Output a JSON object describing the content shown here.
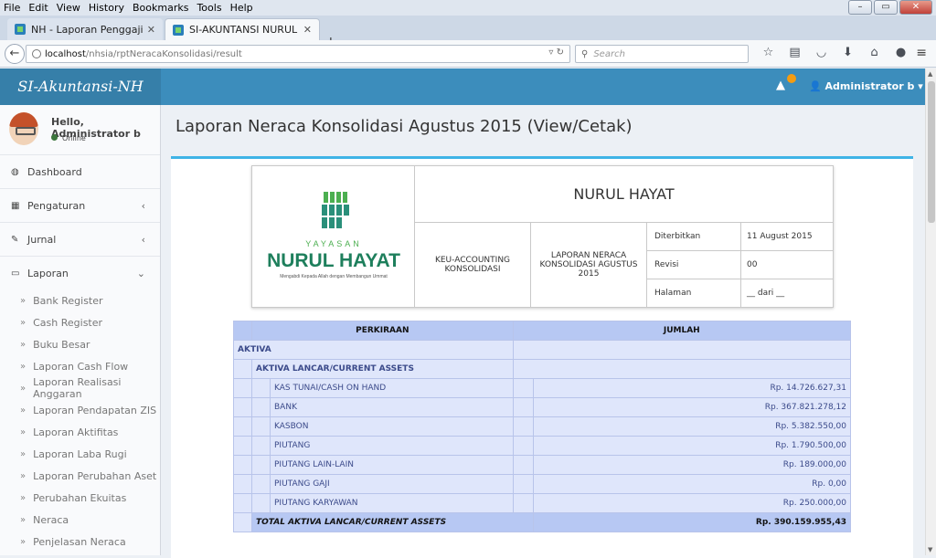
{
  "browser": {
    "menu": [
      "File",
      "Edit",
      "View",
      "History",
      "Bookmarks",
      "Tools",
      "Help"
    ],
    "tabs": [
      {
        "title": "NH - Laporan Penggajian ..."
      },
      {
        "title": "SI-AKUNTANSI NURUL HA..."
      }
    ],
    "url_host": "localhost",
    "url_path": "/nhsia/rptNeracaKonsolidasi/result",
    "search_placeholder": "Search"
  },
  "app": {
    "logo": "SI-Akuntansi-NH",
    "user_menu": "Administrator b"
  },
  "sidebar": {
    "greeting": "Hello, Administrator b",
    "status": "Online",
    "items": [
      {
        "label": "Dashboard"
      },
      {
        "label": "Pengaturan"
      },
      {
        "label": "Jurnal"
      },
      {
        "label": "Laporan"
      }
    ],
    "sub_items": [
      "Bank Register",
      "Cash Register",
      "Buku Besar",
      "Laporan Cash Flow",
      "Laporan Realisasi Anggaran",
      "Laporan Pendapatan ZIS",
      "Laporan Aktifitas",
      "Laporan Laba Rugi",
      "Laporan Perubahan Aset",
      "Perubahan Ekuitas",
      "Neraca",
      "Penjelasan Neraca"
    ]
  },
  "page": {
    "title": "Laporan Neraca Konsolidasi Agustus 2015 (View/Cetak)"
  },
  "letterhead": {
    "logo_top": "YAYASAN",
    "logo_name": "NURUL HAYAT",
    "logo_tagline": "Mengabdi Kepada Allah dengan Membangun Ummat",
    "org": "NURUL HAYAT",
    "dept": "KEU-ACCOUNTING KONSOLIDASI",
    "report": "LAPORAN NERACA KONSOLIDASI AGUSTUS 2015",
    "fields": [
      {
        "k": "Diterbitkan",
        "v": "11 August 2015"
      },
      {
        "k": "Revisi",
        "v": "00"
      },
      {
        "k": "Halaman",
        "v": "__ dari __"
      }
    ]
  },
  "report": {
    "col_account": "PERKIRAAN",
    "col_amount": "JUMLAH",
    "section": "AKTIVA",
    "subsection": "AKTIVA LANCAR/CURRENT ASSETS",
    "rows": [
      {
        "name": "KAS TUNAI/CASH ON HAND",
        "amount": "Rp. 14.726.627,31"
      },
      {
        "name": "BANK",
        "amount": "Rp. 367.821.278,12"
      },
      {
        "name": "KASBON",
        "amount": "Rp. 5.382.550,00"
      },
      {
        "name": "PIUTANG",
        "amount": "Rp. 1.790.500,00"
      },
      {
        "name": "PIUTANG LAIN-LAIN",
        "amount": "Rp. 189.000,00"
      },
      {
        "name": "PIUTANG GAJI",
        "amount": "Rp. 0,00"
      },
      {
        "name": "PIUTANG KARYAWAN",
        "amount": "Rp. 250.000,00"
      }
    ],
    "total_label": "TOTAL AKTIVA LANCAR/CURRENT ASSETS",
    "total_amount": "Rp. 390.159.955,43"
  }
}
